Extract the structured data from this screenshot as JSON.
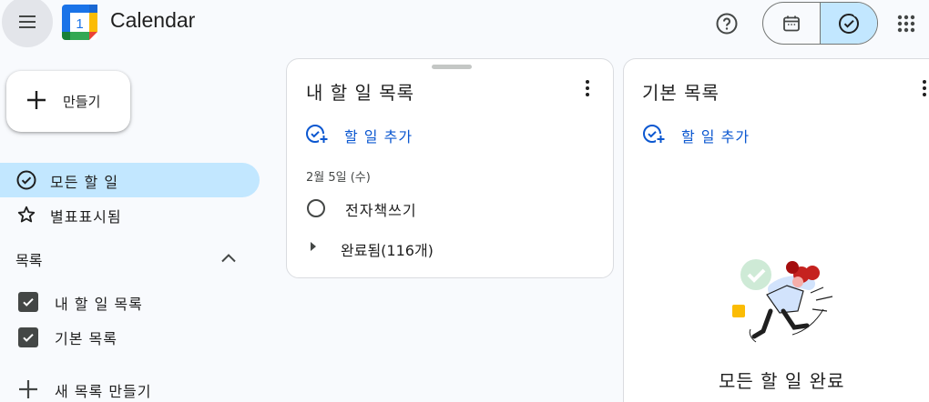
{
  "header": {
    "app_title": "Calendar",
    "logo_day": "1",
    "menu_icon": "hamburger-menu-icon",
    "help_icon": "help-circle-icon",
    "apps_icon": "apps-grid-icon",
    "view_toggle": {
      "calendar_icon": "calendar-icon",
      "tasks_icon": "tasks-check-icon",
      "active": "tasks"
    }
  },
  "sidebar": {
    "create_label": "만들기",
    "nav": [
      {
        "label": "모든 할 일",
        "icon": "check-circle-icon",
        "active": true
      },
      {
        "label": "별표표시됨",
        "icon": "star-outline-icon",
        "active": false
      }
    ],
    "lists_heading": "목록",
    "lists": [
      {
        "label": "내 할 일 목록",
        "checked": true
      },
      {
        "label": "기본 목록",
        "checked": true
      }
    ],
    "new_list_label": "새 목록 만들기"
  },
  "cards": {
    "my_tasks": {
      "title": "내 할 일 목록",
      "add_task_label": "할 일 추가",
      "date_heading": "2월 5일 (수)",
      "tasks": [
        {
          "title": "전자책쓰기",
          "done": false
        }
      ],
      "completed_label": "완료됨(116개)"
    },
    "default_list": {
      "title": "기본 목록",
      "add_task_label": "할 일 추가",
      "empty_message": "모든 할 일 완료"
    }
  },
  "colors": {
    "accent_blue": "#0b57d0",
    "active_bg": "#c2e7ff",
    "page_bg": "#f8fafd"
  }
}
